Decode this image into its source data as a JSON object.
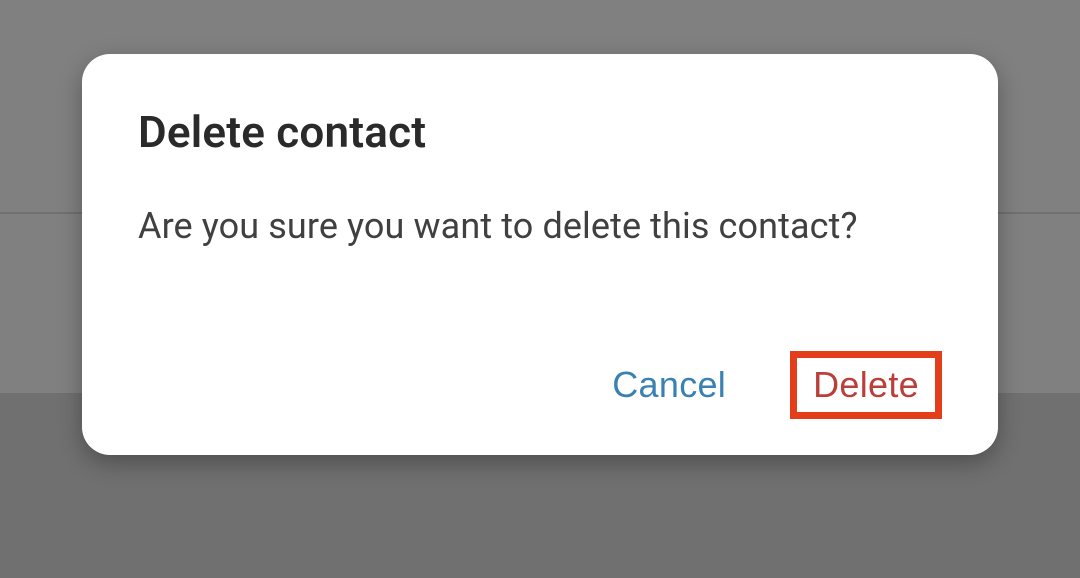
{
  "dialog": {
    "title": "Delete contact",
    "message": "Are you sure you want to delete this contact?",
    "actions": {
      "cancel_label": "Cancel",
      "delete_label": "Delete"
    }
  }
}
